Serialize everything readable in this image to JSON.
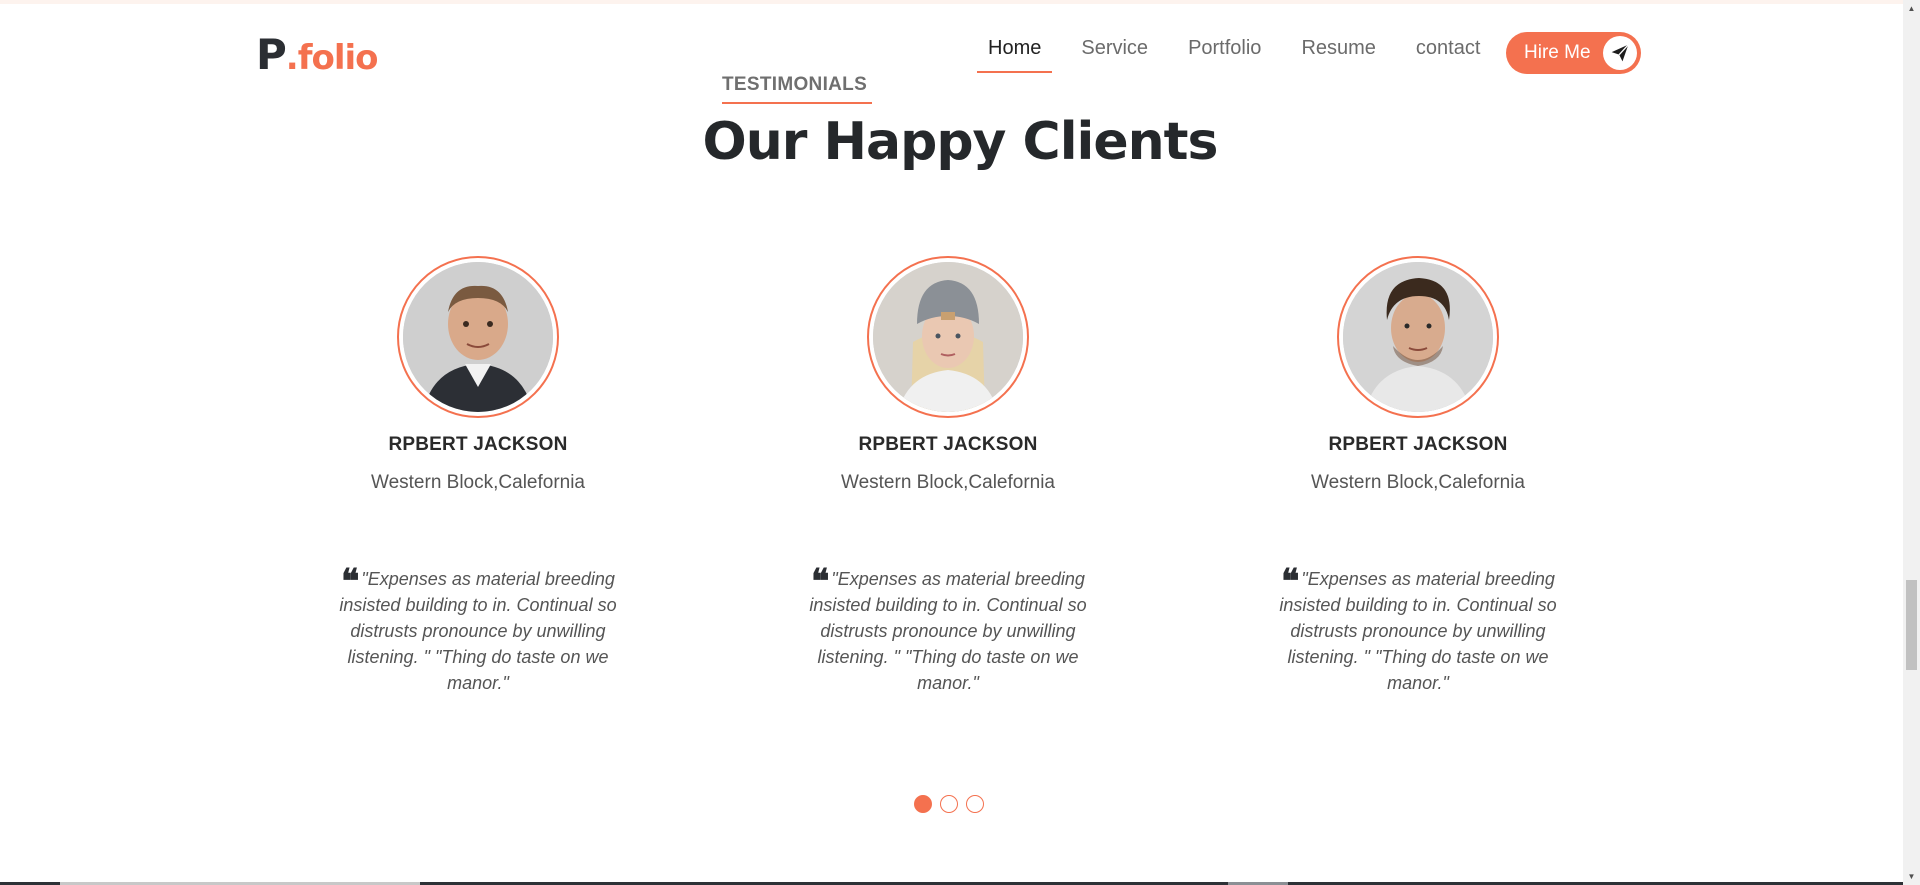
{
  "logo": {
    "letter": "P",
    "suffix": ".folio"
  },
  "nav": {
    "items": [
      {
        "label": "Home",
        "active": true
      },
      {
        "label": "Service",
        "active": false
      },
      {
        "label": "Portfolio",
        "active": false
      },
      {
        "label": "Resume",
        "active": false
      },
      {
        "label": "contact",
        "active": false
      }
    ],
    "hire_label": "Hire Me",
    "hire_icon": "paper-plane-icon"
  },
  "section": {
    "eyebrow": "TESTIMONIALS",
    "title": "Our Happy Clients"
  },
  "testimonials": [
    {
      "name": "RPBERT JACKSON",
      "location": "Western Block,Calefornia",
      "quote_mark": "❝",
      "quote": "\"Expenses as material breeding insisted building to in. Continual so distrusts pronounce by unwilling listening. \" \"Thing do taste on we manor.\""
    },
    {
      "name": "RPBERT JACKSON",
      "location": "Western Block,Calefornia",
      "quote_mark": "❝",
      "quote": "\"Expenses as material breeding insisted building to in. Continual so distrusts pronounce by unwilling listening. \" \"Thing do taste on we manor.\""
    },
    {
      "name": "RPBERT JACKSON",
      "location": "Western Block,Calefornia",
      "quote_mark": "❝",
      "quote": "\"Expenses as material breeding insisted building to in. Continual so distrusts pronounce by unwilling listening. \" \"Thing do taste on we manor.\""
    }
  ],
  "carousel": {
    "pages": 3,
    "active_index": 0
  },
  "colors": {
    "accent": "#f4714f",
    "dark": "#25282b",
    "muted": "#6b6b6b"
  }
}
